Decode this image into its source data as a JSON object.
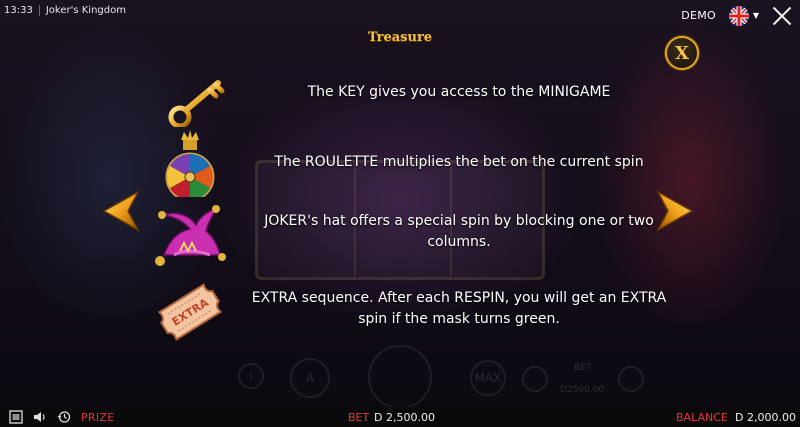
{
  "topbar": {
    "time": "13:33",
    "title": "Joker's Kingdom"
  },
  "header": {
    "mode_label": "DEMO",
    "language": "English (UK)"
  },
  "panel": {
    "title": "Treasure",
    "close_label": "X",
    "rows": [
      {
        "icon": "key-icon",
        "text": "The KEY gives you access to the MINIGAME"
      },
      {
        "icon": "roulette-icon",
        "text": "The ROULETTE multiplies the bet on the current spin"
      },
      {
        "icon": "jester-hat-icon",
        "text": "JOKER's hat offers a special spin by blocking one or two columns."
      },
      {
        "icon": "extra-ticket-icon",
        "text": "EXTRA sequence. After each RESPIN, you will get an EXTRA spin if the mask turns green.",
        "ticket_label": "EXTRA"
      }
    ]
  },
  "background_controls": {
    "bet_label": "BET",
    "bet_value": "D2500.00",
    "max_label": "MAX",
    "auto_label": "A",
    "info_label": "i"
  },
  "bottombar": {
    "prize_label": "PRIZE",
    "bet_label": "BET",
    "bet_value": "D 2,500.00",
    "balance_label": "BALANCE",
    "balance_value": "D 2,000.00"
  },
  "colors": {
    "accent_gold": "#f3c23a",
    "label_red": "#e03a3a",
    "text_white": "#ffffff"
  }
}
